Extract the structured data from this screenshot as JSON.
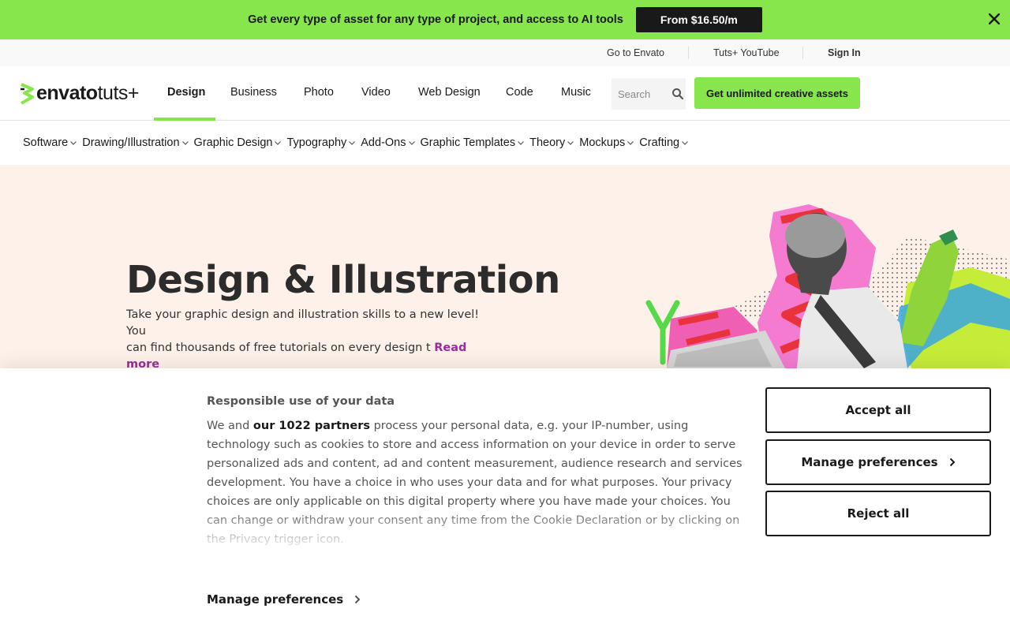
{
  "promo": {
    "text": "Get every type of asset for any type of project, and access to AI tools",
    "button": "From $16.50/m"
  },
  "utility": {
    "links": [
      "Go to Envato",
      "Tuts+ YouTube",
      "Sign In"
    ]
  },
  "header": {
    "logo_brand": "envato",
    "logo_suffix": "tuts+",
    "nav": [
      "Design",
      "Business",
      "Photo",
      "Video",
      "Web Design",
      "Code",
      "Music"
    ],
    "active_nav": "Design",
    "search_placeholder": "Search",
    "cta": "Get unlimited creative assets"
  },
  "categories": [
    "Software",
    "Drawing/Illustration",
    "Graphic Design",
    "Typography",
    "Add-Ons",
    "Graphic Templates",
    "Theory",
    "Mockups",
    "Crafting"
  ],
  "hero": {
    "title": "Design & Illustration",
    "desc_line1": "Take your graphic design and illustration skills to a new level! You",
    "desc_line2": "can find thousands of free tutorials on every design t",
    "read_more": "Read more"
  },
  "cookie": {
    "title": "Responsible use of your data",
    "body_pre": "We and ",
    "body_bold": "our 1022 partners",
    "body_post": " process your personal data, e.g. your IP-number, using technology such as cookies to store and access information on your device in order to serve personalized ads and content, ad and content measurement, audience research and services development. You have a choice in who uses your data and for what purposes. Your privacy choices are only applicable on this digital property where you have made your choices. You can change or withdraw your consent any time from the Cookie Declaration or by clicking on the Privacy trigger icon.",
    "manage_link": "Manage preferences",
    "accept": "Accept all",
    "manage": "Manage preferences",
    "reject": "Reject all"
  },
  "colors": {
    "accent_green": "#87e64b",
    "hero_bg": "#fdf1e9",
    "read_more": "#9b2b9b",
    "dark": "#191919"
  }
}
